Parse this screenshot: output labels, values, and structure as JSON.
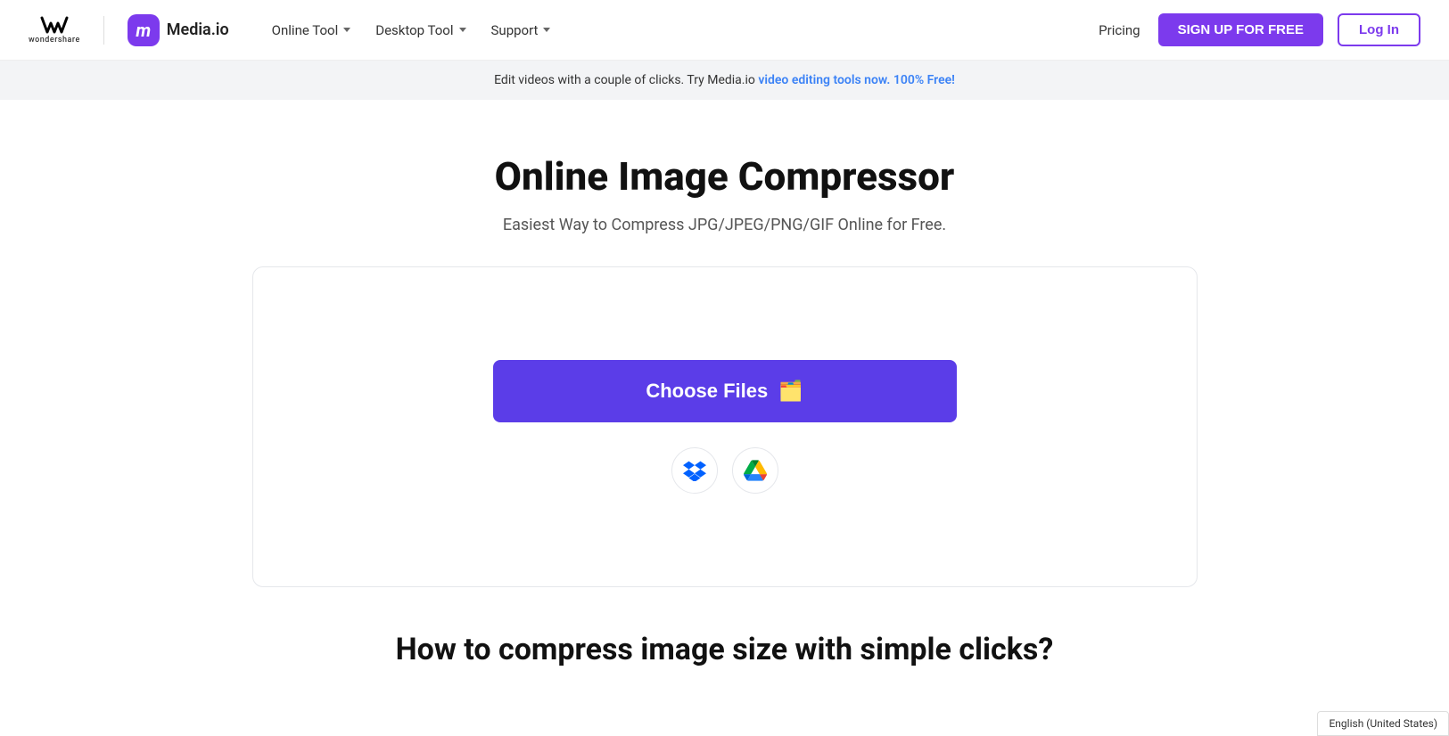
{
  "brand": {
    "wondershare_label": "wondershare",
    "media_io_letter": "m",
    "media_io_name": "Media.io"
  },
  "nav": {
    "online_tool": "Online Tool",
    "desktop_tool": "Desktop Tool",
    "support": "Support",
    "pricing": "Pricing",
    "signup": "SIGN UP FOR FREE",
    "login": "Log In"
  },
  "banner": {
    "text": "Edit videos with a couple of clicks. Try Media.io ",
    "link_text": "video editing tools now. 100% Free!"
  },
  "hero": {
    "title": "Online Image Compressor",
    "subtitle": "Easiest Way to Compress JPG/JPEG/PNG/GIF Online for Free."
  },
  "upload": {
    "choose_files_label": "Choose Files",
    "folder_icon": "🗂",
    "dropbox_label": "Dropbox",
    "google_drive_label": "Google Drive"
  },
  "how_to": {
    "title": "How to compress image size with simple clicks?"
  },
  "language": {
    "label": "English (United States)"
  }
}
